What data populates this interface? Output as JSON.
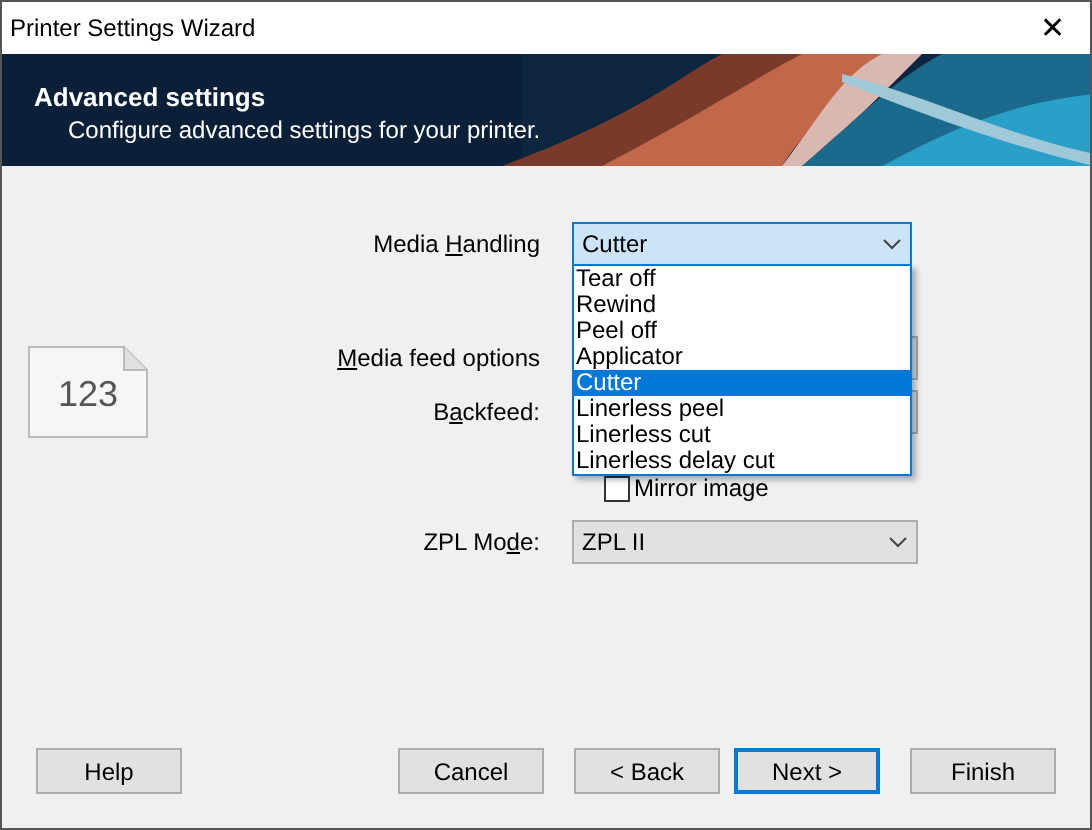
{
  "window": {
    "title": "Printer Settings Wizard",
    "close": "✕"
  },
  "header": {
    "title": "Advanced settings",
    "subtitle": "Configure advanced settings for your printer."
  },
  "icon_text": "123",
  "media_handling": {
    "label": {
      "before": "Media ",
      "key": "H",
      "after": "andling"
    },
    "value": "Cutter",
    "expanded": true,
    "options": [
      {
        "label": "Tear off",
        "selected": false
      },
      {
        "label": "Rewind",
        "selected": false
      },
      {
        "label": "Peel off",
        "selected": false
      },
      {
        "label": "Applicator",
        "selected": false
      },
      {
        "label": "Cutter",
        "selected": true
      },
      {
        "label": "Linerless peel",
        "selected": false
      },
      {
        "label": "Linerless cut",
        "selected": false
      },
      {
        "label": "Linerless delay cut",
        "selected": false
      }
    ]
  },
  "media_feed": {
    "label": {
      "key": "M",
      "after": "edia feed options"
    }
  },
  "backfeed": {
    "label": {
      "before": "B",
      "key": "a",
      "after": "ckfeed:"
    }
  },
  "mirror_image": {
    "label": "Mirror image",
    "checked": false
  },
  "zpl_mode": {
    "label": {
      "before": "ZPL Mo",
      "key": "d",
      "after": "e:"
    },
    "value": "ZPL II"
  },
  "buttons": [
    {
      "label": "Help",
      "focused": false
    },
    {
      "label": "Cancel",
      "focused": false
    },
    {
      "label": "< Back",
      "focused": false
    },
    {
      "label": "Next >",
      "focused": true
    },
    {
      "label": "Finish",
      "focused": false
    }
  ]
}
